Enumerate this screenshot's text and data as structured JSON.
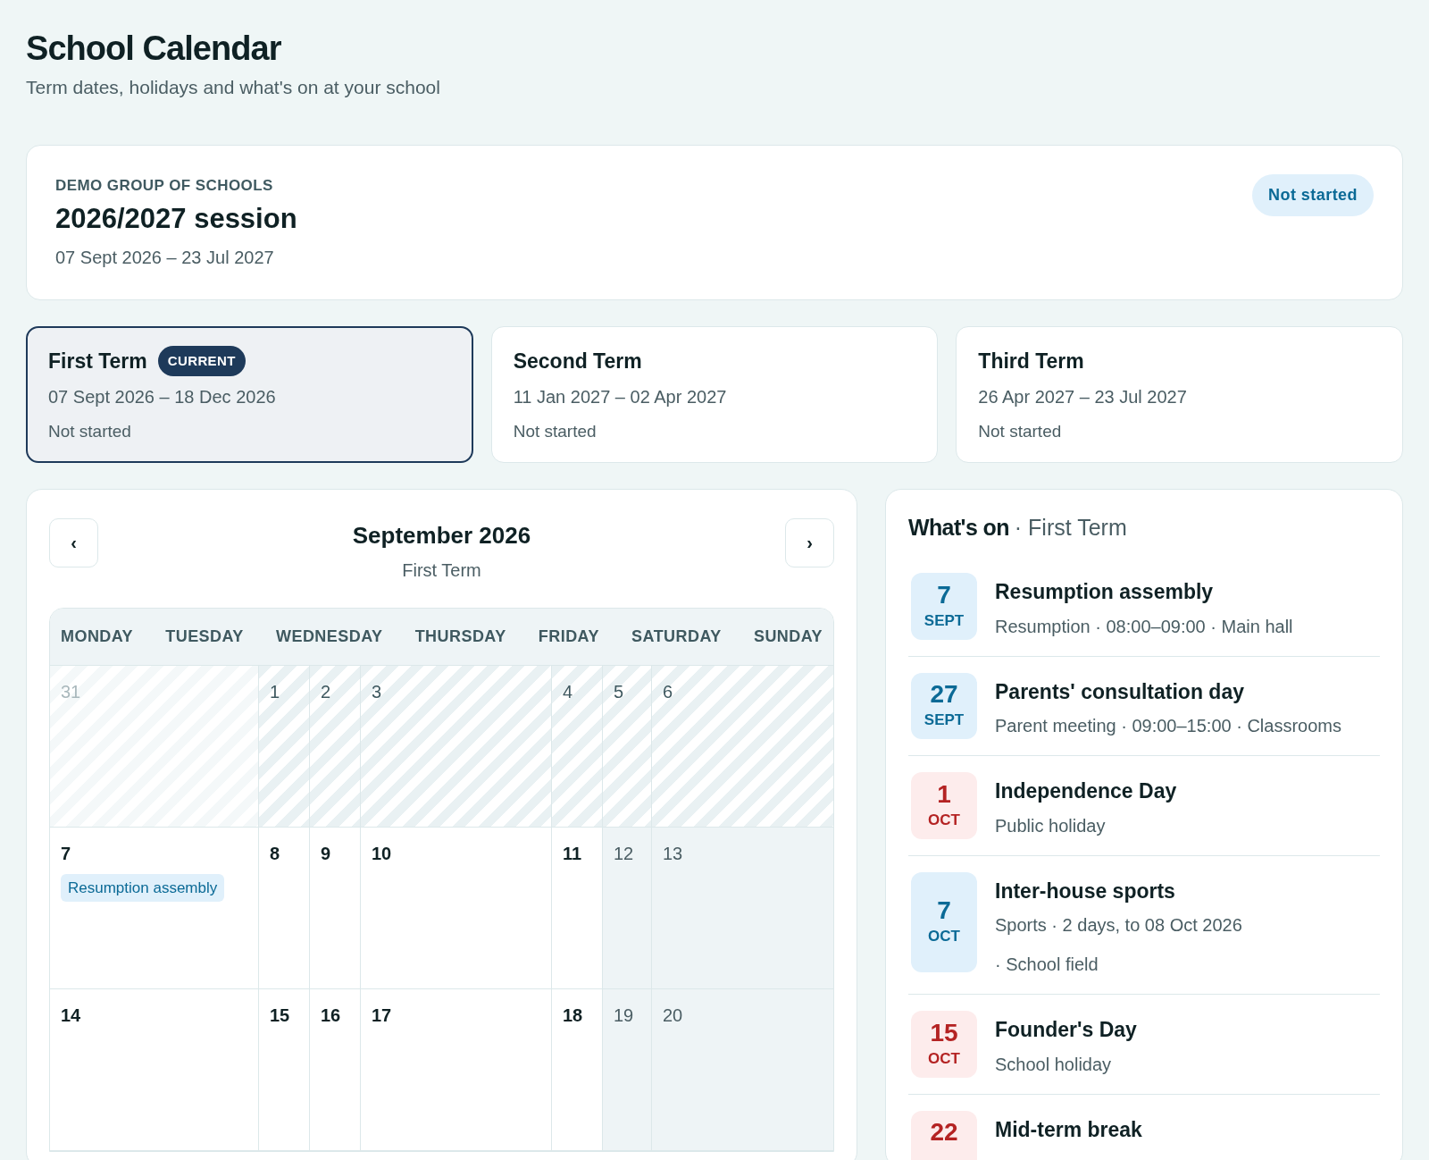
{
  "page": {
    "title": "School Calendar",
    "subtitle": "Term dates, holidays and what's on at your school"
  },
  "session": {
    "group": "DEMO GROUP OF SCHOOLS",
    "title": "2026/2027 session",
    "dates": "07 Sept 2026 – 23 Jul 2027",
    "status": "Not started"
  },
  "terms": [
    {
      "name": "First Term",
      "badge": "CURRENT",
      "dates": "07 Sept 2026 – 18 Dec 2026",
      "status": "Not started",
      "selected": true
    },
    {
      "name": "Second Term",
      "dates": "11 Jan 2027 – 02 Apr 2027",
      "status": "Not started",
      "selected": false
    },
    {
      "name": "Third Term",
      "dates": "26 Apr 2027 – 23 Jul 2027",
      "status": "Not started",
      "selected": false
    }
  ],
  "calendar": {
    "prev": "‹",
    "next": "›",
    "month": "September 2026",
    "term": "First Term",
    "weekdays": [
      "MONDAY",
      "TUESDAY",
      "WEDNESDAY",
      "THURSDAY",
      "FRIDAY",
      "SATURDAY",
      "SUNDAY"
    ],
    "weeks": [
      [
        {
          "label": "31",
          "kind": "outside"
        },
        {
          "label": "1",
          "kind": "before_term"
        },
        {
          "label": "2",
          "kind": "before_term"
        },
        {
          "label": "3",
          "kind": "before_term"
        },
        {
          "label": "4",
          "kind": "before_term"
        },
        {
          "label": "5",
          "kind": "before_term"
        },
        {
          "label": "6",
          "kind": "before_term"
        }
      ],
      [
        {
          "label": "7",
          "kind": "weekday",
          "events": [
            "Resumption assembly"
          ]
        },
        {
          "label": "8",
          "kind": "weekday"
        },
        {
          "label": "9",
          "kind": "weekday"
        },
        {
          "label": "10",
          "kind": "weekday"
        },
        {
          "label": "11",
          "kind": "weekday"
        },
        {
          "label": "12",
          "kind": "weekend"
        },
        {
          "label": "13",
          "kind": "weekend"
        }
      ],
      [
        {
          "label": "14",
          "kind": "weekday"
        },
        {
          "label": "15",
          "kind": "weekday"
        },
        {
          "label": "16",
          "kind": "weekday"
        },
        {
          "label": "17",
          "kind": "weekday"
        },
        {
          "label": "18",
          "kind": "weekday"
        },
        {
          "label": "19",
          "kind": "weekend"
        },
        {
          "label": "20",
          "kind": "weekend"
        }
      ]
    ]
  },
  "whats_on": {
    "title": "What's on",
    "term": "· First Term",
    "events": [
      {
        "day": "7",
        "month": "SEPT",
        "kind": "event",
        "title": "Resumption assembly",
        "details": [
          "Resumption · 08:00–09:00 · Main hall"
        ]
      },
      {
        "day": "27",
        "month": "SEPT",
        "kind": "event",
        "title": "Parents' consultation day",
        "details": [
          "Parent meeting · 09:00–15:00 · Classrooms"
        ]
      },
      {
        "day": "1",
        "month": "OCT",
        "kind": "holiday",
        "title": "Independence Day",
        "details": [
          "Public holiday"
        ]
      },
      {
        "day": "7",
        "month": "OCT",
        "kind": "event",
        "title": "Inter-house sports",
        "details": [
          "Sports · 2 days, to 08 Oct 2026",
          "· School field"
        ]
      },
      {
        "day": "15",
        "month": "OCT",
        "kind": "holiday",
        "title": "Founder's Day",
        "details": [
          "School holiday"
        ]
      },
      {
        "day": "22",
        "kind": "holiday",
        "title": "Mid-term break"
      }
    ]
  }
}
